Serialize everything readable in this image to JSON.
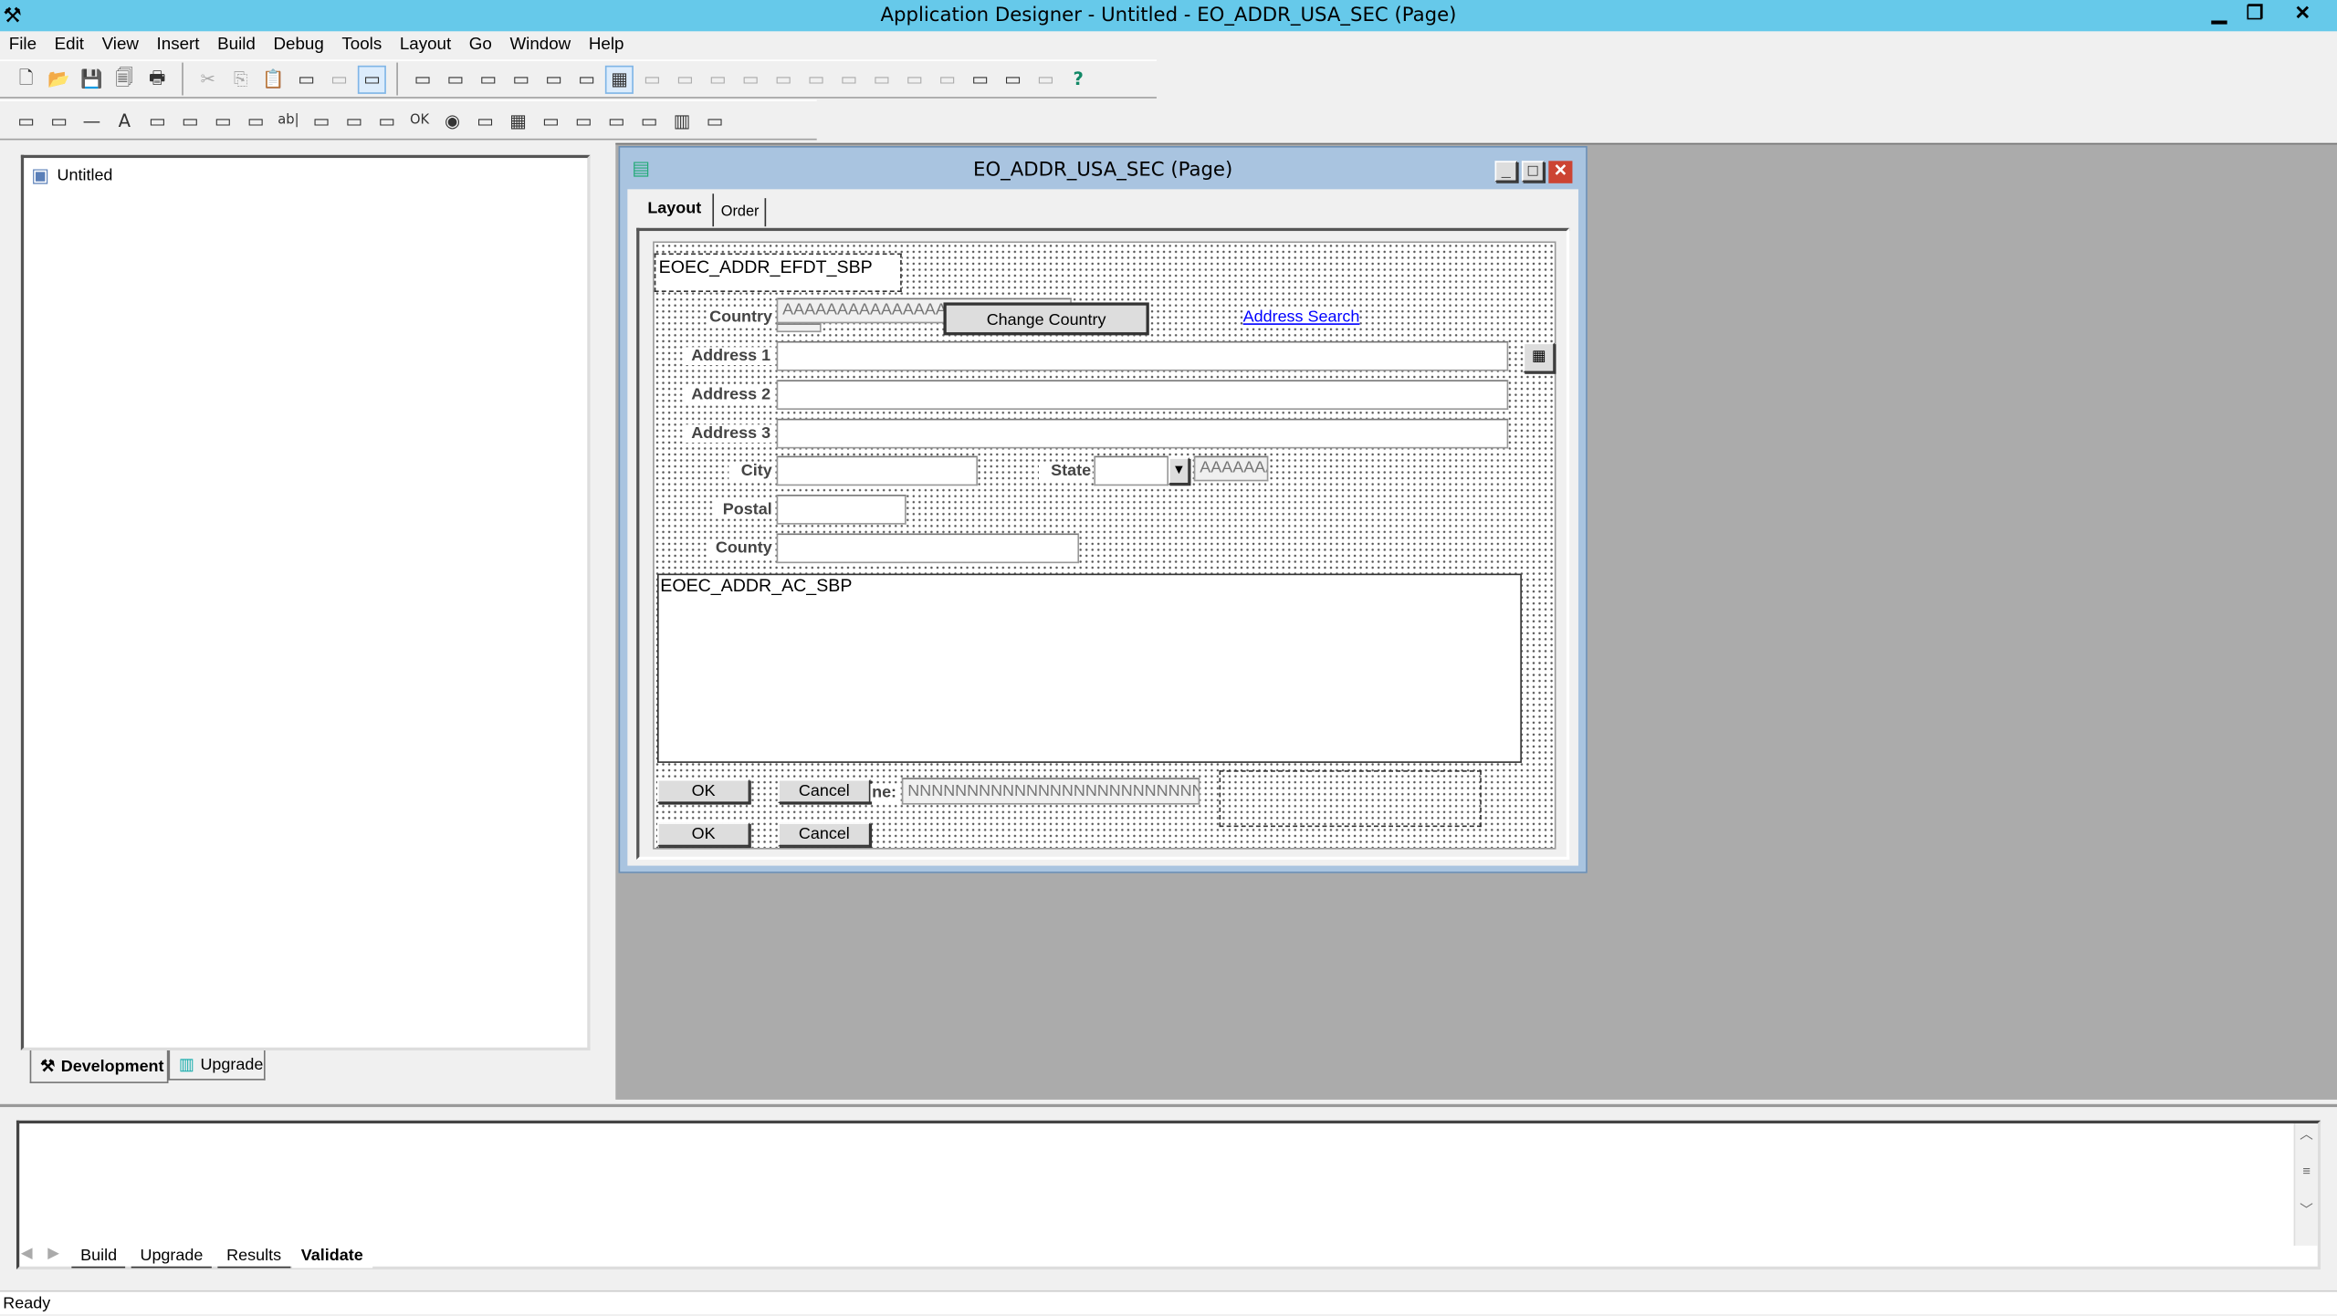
{
  "app": {
    "title": "Application Designer - Untitled - EO_ADDR_USA_SEC (Page)",
    "title_bg": "#66c9ea"
  },
  "menu": [
    "File",
    "Edit",
    "View",
    "Insert",
    "Build",
    "Debug",
    "Tools",
    "Layout",
    "Go",
    "Window",
    "Help"
  ],
  "toolbar1": [
    "new-icon",
    "open-icon",
    "save-icon",
    "save-all-icon",
    "print-icon",
    "|",
    "cut-icon",
    "copy-icon",
    "paste-icon",
    "properties-icon",
    "disabled-icon",
    "view-definition-icon",
    "|",
    "select-icon",
    "page-icon",
    "record-icon",
    "component-icon",
    "peoplecode-icon",
    "field-list-icon",
    "grid-icon",
    "disabled-icon",
    "align-left-icon",
    "align-center-icon",
    "align-right-icon",
    "align-top-icon",
    "align-middle-icon",
    "align-bottom-icon",
    "space-left-icon",
    "space-center-icon",
    "space-right-icon",
    "size-icon",
    "test-icon",
    "disabled-icon",
    "help-icon"
  ],
  "toolbar2": [
    "frame-icon",
    "group-box-icon",
    "line-icon",
    "text-icon",
    "image-icon",
    "push-button-icon",
    "checkbox-icon",
    "grid-box-icon",
    "edit-box-icon",
    "long-edit-icon",
    "image-field-icon",
    "listbox-icon",
    "ok-button-icon",
    "radio-icon",
    "tree-icon",
    "grid-icon",
    "scroll-area-icon",
    "scroll-bar-icon",
    "subpage-icon",
    "secondary-page-icon",
    "chart-icon",
    "analytic-icon"
  ],
  "project": {
    "root": "Untitled",
    "tabs": [
      "Development",
      "Upgrade"
    ]
  },
  "child": {
    "title": "EO_ADDR_USA_SEC (Page)",
    "tabs": [
      "Layout",
      "Order"
    ],
    "title_bg": "#a9c4e0"
  },
  "page": {
    "subpage1": "EOEC_ADDR_EFDT_SBP",
    "country_label": "Country",
    "country_value": "AAAAAAAAAAAAAAAAAAAAAAAAAAAAAA",
    "change_country": "Change Country",
    "address_search": "Address Search",
    "address1": "Address 1",
    "address2": "Address 2",
    "address3": "Address 3",
    "city": "City",
    "state": "State",
    "state_desc": "AAAAAAAAAA",
    "postal": "Postal",
    "county": "County",
    "subpage2": "EOEC_ADDR_AC_SBP",
    "ok": "OK",
    "cancel": "Cancel",
    "partial_label": "ne:",
    "n_field": "NNNNNNNNNNNNNNNNNNNNNNNNNNNNNN",
    "link_color": "#0000ff"
  },
  "output": {
    "tabs": [
      "Build",
      "Upgrade",
      "Results",
      "Validate"
    ],
    "active": "Validate"
  },
  "status": "Ready"
}
